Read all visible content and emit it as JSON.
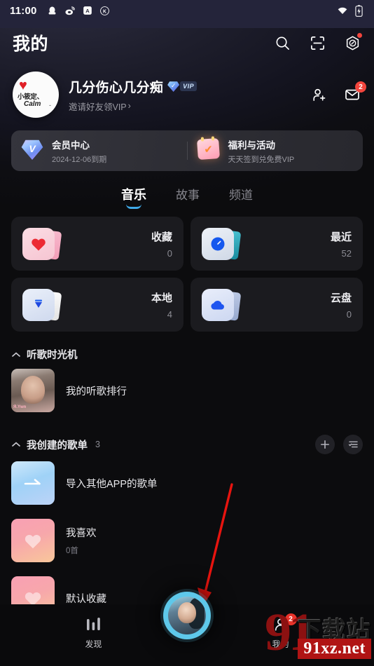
{
  "status_bar": {
    "time": "11:00",
    "icons": [
      "qq-icon",
      "weibo-icon",
      "alipay-icon",
      "kugou-icon"
    ],
    "right_icons": [
      "wifi-icon",
      "battery-icon"
    ]
  },
  "header": {
    "title": "我的",
    "actions": [
      {
        "name": "search-icon"
      },
      {
        "name": "scan-icon"
      },
      {
        "name": "car-mode-icon",
        "badge": true
      }
    ]
  },
  "profile": {
    "avatar": {
      "name": "user-avatar",
      "heart": "♥",
      "text_line1": "小筱定、",
      "text_line2": "Calm",
      "text_line3": "-"
    },
    "username": "几分伤心几分痴",
    "vip_label": "VIP",
    "vip_mark": "✓",
    "subtitle": "邀请好友领VIP",
    "subtitle_arrow": "›",
    "add_friend_icon": "add-friend-icon",
    "message_icon": "message-icon",
    "message_badge": "2"
  },
  "vip_banner": {
    "left": {
      "icon": "vip-gem-icon",
      "gem_mark": "V",
      "title": "会员中心",
      "subtitle": "2024-12-06到期"
    },
    "right": {
      "icon": "calendar-gift-icon",
      "calendar_mark": "✔",
      "title": "福利与活动",
      "subtitle": "天天签到兑免费VIP"
    }
  },
  "tabs": [
    {
      "label": "音乐",
      "active": true
    },
    {
      "label": "故事",
      "active": false
    },
    {
      "label": "频道",
      "active": false
    }
  ],
  "grid": [
    {
      "icon": "heart-icon",
      "name": "收藏",
      "count": "0",
      "front_color": "#f6ccd6",
      "back_color": "#f4a8bf"
    },
    {
      "icon": "clock-icon",
      "name": "最近",
      "count": "52",
      "front_color": "#e0e6ef",
      "back_color": "#3fb7c9"
    },
    {
      "icon": "download-icon",
      "name": "本地",
      "count": "4",
      "front_color": "#dce6f6",
      "back_color": "#f2f2f2"
    },
    {
      "icon": "cloud-icon",
      "name": "云盘",
      "count": "0",
      "front_color": "#dde5f8",
      "back_color": "#9fb0d6"
    }
  ],
  "sections": [
    {
      "title": "听歌时光机",
      "count": "",
      "chevron": "collapse-chevron-icon",
      "rows": [
        {
          "cover": "portrait-cover",
          "cover_tag": "Я.Ywn",
          "title": "我的听歌排行",
          "subtitle": ""
        }
      ]
    },
    {
      "title": "我创建的歌单",
      "count": "3",
      "chevron": "collapse-chevron-icon",
      "actions": [
        {
          "name": "add-playlist-button",
          "glyph": "+"
        },
        {
          "name": "sort-playlist-button",
          "glyph": "sort-icon"
        }
      ],
      "rows": [
        {
          "cover": "import-cover",
          "title": "导入其他APP的歌单",
          "subtitle": ""
        },
        {
          "cover": "like-cover",
          "title": "我喜欢",
          "subtitle": "0首"
        },
        {
          "cover": "like-cover",
          "title": "默认收藏",
          "subtitle": ""
        }
      ]
    }
  ],
  "bottom_nav": {
    "items": [
      {
        "name": "nav-discover",
        "icon": "bars-icon",
        "label": "发现",
        "badge": ""
      },
      {
        "name": "nav-mine",
        "icon": "person-icon",
        "label": "我的",
        "badge": "2"
      }
    ],
    "play_button": {
      "name": "mini-player-avatar"
    }
  },
  "watermark": {
    "logo": "91",
    "cn": "下载站",
    "url": "91xz.net"
  },
  "colors": {
    "accent_blue": "#3fa9e8",
    "badge_red": "#f2453d",
    "bg": "#0c0c0e",
    "card": "#1b1b1f",
    "watermark_red": "#b01414"
  }
}
